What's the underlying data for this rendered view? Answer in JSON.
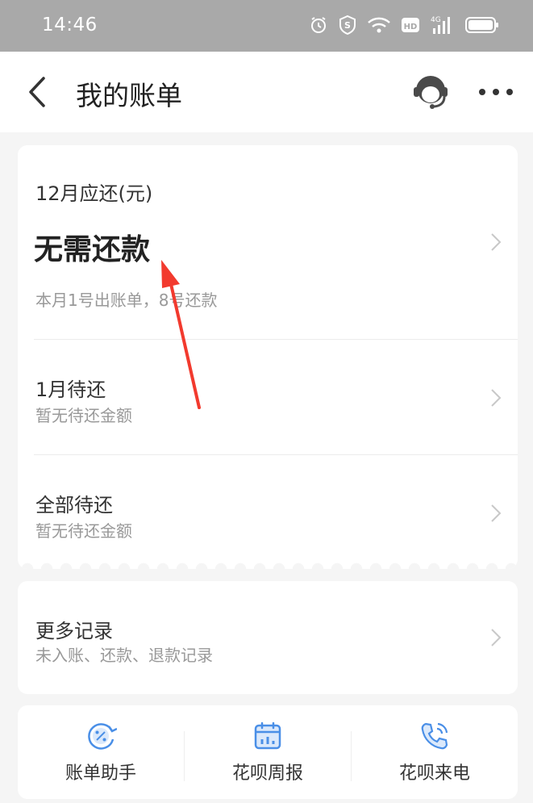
{
  "status_bar": {
    "time": "14:46",
    "network_label": "4G"
  },
  "nav": {
    "title": "我的账单"
  },
  "bill": {
    "due_label": "12月应还(元)",
    "due_amount": "无需还款",
    "due_note": "本月1号出账单，8号还款",
    "next_title": "1月待还",
    "next_sub": "暂无待还金额",
    "all_title": "全部待还",
    "all_sub": "暂无待还金额"
  },
  "more_records": {
    "title": "更多记录",
    "sub": "未入账、还款、退款记录"
  },
  "tools": [
    {
      "label": "账单助手",
      "icon": "percent-cycle-icon"
    },
    {
      "label": "花呗周报",
      "icon": "calendar-chart-icon"
    },
    {
      "label": "花呗来电",
      "icon": "phone-call-icon"
    }
  ],
  "colors": {
    "accent_blue": "#4a8fe7",
    "annotation_red": "#f23a2e"
  }
}
